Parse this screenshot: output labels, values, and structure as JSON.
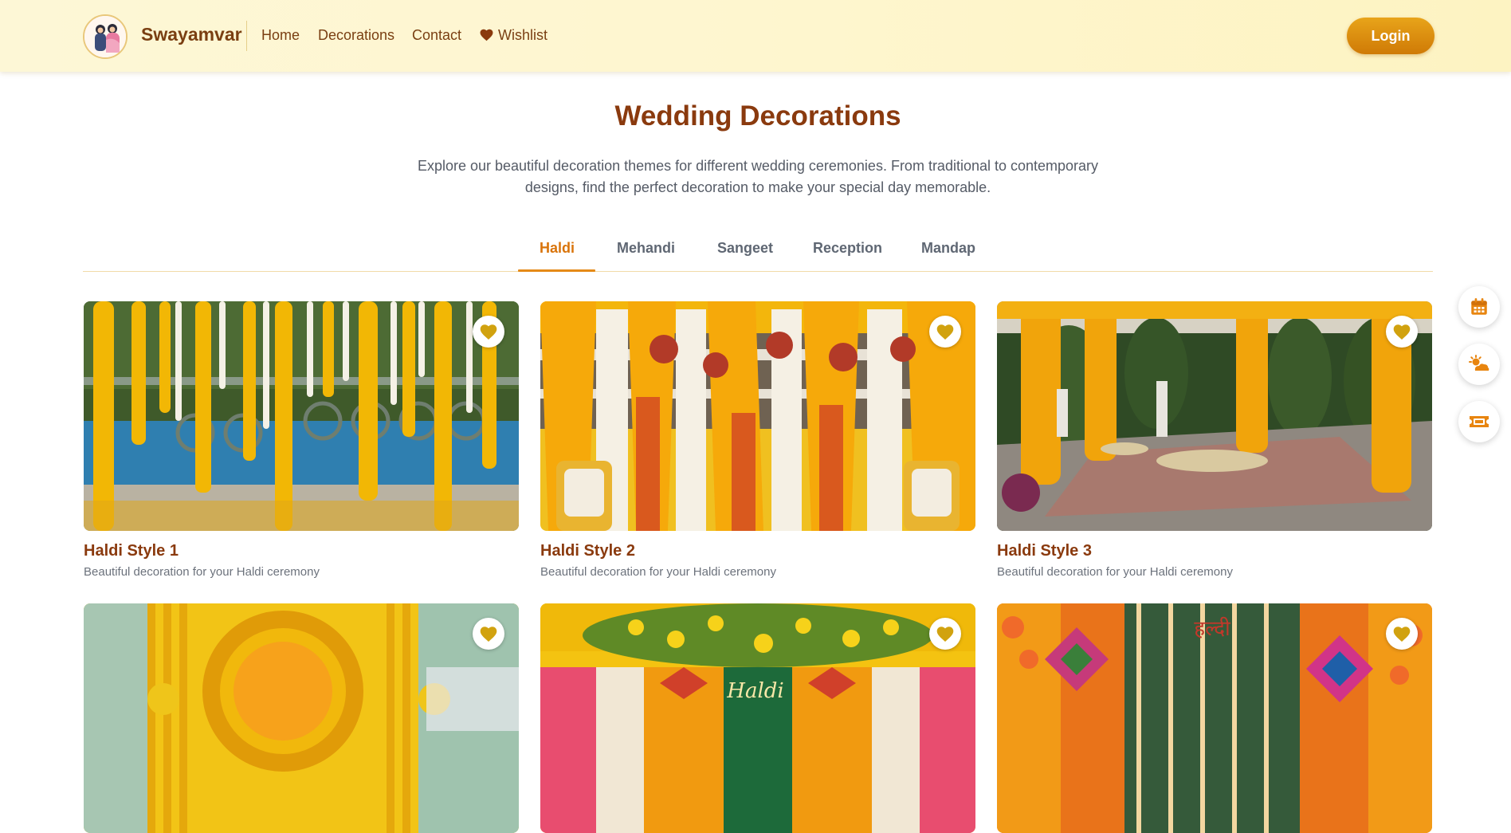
{
  "header": {
    "brand": "Swayamvar",
    "nav": {
      "home": "Home",
      "decorations": "Decorations",
      "contact": "Contact",
      "wishlist": "Wishlist"
    },
    "login_label": "Login"
  },
  "hero": {
    "title": "Wedding Decorations",
    "description": "Explore our beautiful decoration themes for different wedding ceremonies. From traditional to contemporary designs, find the perfect decoration to make your special day memorable."
  },
  "tabs": [
    {
      "label": "Haldi",
      "active": true
    },
    {
      "label": "Mehandi",
      "active": false
    },
    {
      "label": "Sangeet",
      "active": false
    },
    {
      "label": "Reception",
      "active": false
    },
    {
      "label": "Mandap",
      "active": false
    }
  ],
  "cards": [
    {
      "title": "Haldi Style 1",
      "description": "Beautiful decoration for your Haldi ceremony"
    },
    {
      "title": "Haldi Style 2",
      "description": "Beautiful decoration for your Haldi ceremony"
    },
    {
      "title": "Haldi Style 3",
      "description": "Beautiful decoration for your Haldi ceremony"
    },
    {
      "title": "",
      "description": ""
    },
    {
      "title": "",
      "description": ""
    },
    {
      "title": "",
      "description": ""
    }
  ],
  "photo_text": {
    "card5_sign": "Haldi",
    "card6_sign": "हल्दी"
  },
  "side_buttons": [
    "calendar-icon",
    "weather-icon",
    "ticket-icon"
  ],
  "colors": {
    "brand_brown": "#8a3a0e",
    "accent_orange": "#d9740b",
    "login_gradient_top": "#e8a41a",
    "login_gradient_bottom": "#cf7a06",
    "heart_gold": "#d1a20f",
    "header_bg": "#fef6cf"
  }
}
